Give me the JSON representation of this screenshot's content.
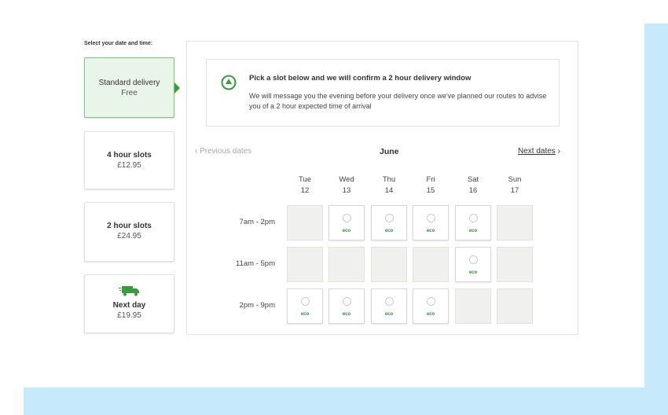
{
  "colors": {
    "accent": "#3b9a3b",
    "selected_bg": "#e9f5e8",
    "background_accent": "#c6e9fc",
    "eco": "#2e8b3e"
  },
  "select_label": "Select your date and time:",
  "options": [
    {
      "title": "Standard delivery",
      "price": "Free",
      "selected": true
    },
    {
      "title": "4 hour slots",
      "price": "£12.95"
    },
    {
      "title": "2 hour slots",
      "price": "£24.95"
    },
    {
      "title": "Next day",
      "price": "£19.95",
      "icon": "truck-icon"
    }
  ],
  "info": {
    "icon": "clock-icon",
    "title": "Pick a slot below and we will confirm a 2 hour delivery window",
    "body": "We will message you the evening before your delivery once we've planned our routes to advise you of a 2 hour expected time of arrival"
  },
  "nav": {
    "prev": "Previous dates",
    "month": "June",
    "next": "Next dates"
  },
  "days": [
    {
      "name": "Tue",
      "date": "12"
    },
    {
      "name": "Wed",
      "date": "13"
    },
    {
      "name": "Thu",
      "date": "14"
    },
    {
      "name": "Fri",
      "date": "15"
    },
    {
      "name": "Sat",
      "date": "16"
    },
    {
      "name": "Sun",
      "date": "17"
    }
  ],
  "slots": [
    {
      "time": "7am - 2pm",
      "cells": [
        "na",
        "eco",
        "eco",
        "eco",
        "eco",
        "na"
      ]
    },
    {
      "time": "11am - 5pm",
      "cells": [
        "na",
        "na",
        "na",
        "na",
        "eco",
        "na"
      ]
    },
    {
      "time": "2pm - 9pm",
      "cells": [
        "eco",
        "eco",
        "eco",
        "eco",
        "na",
        "na"
      ]
    }
  ],
  "eco_label": "eco"
}
